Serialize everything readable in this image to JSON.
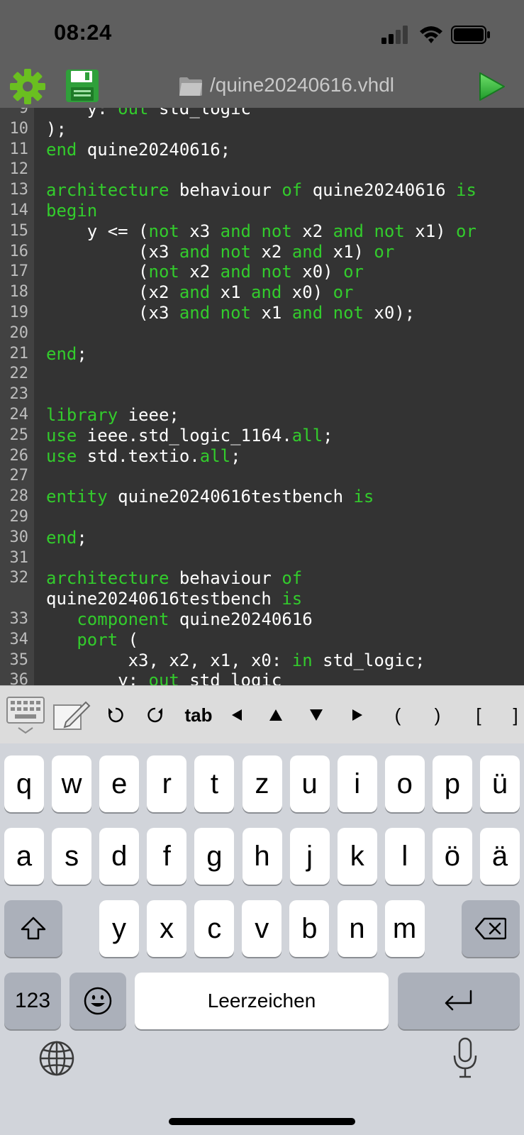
{
  "status_bar": {
    "time": "08:24"
  },
  "toolbar": {
    "file_title": "/quine20240616.vhdl"
  },
  "colors": {
    "keyword": "#33cc2c",
    "text": "#ffffff",
    "editor_bg": "#333333",
    "gutter_bg": "#424242"
  },
  "code": {
    "lines": [
      {
        "num": "9",
        "segs": [
          [
            "t",
            "    y: "
          ],
          [
            "k",
            "out"
          ],
          [
            "t",
            " std_logic"
          ]
        ]
      },
      {
        "num": "10",
        "segs": [
          [
            "t",
            ");"
          ]
        ]
      },
      {
        "num": "11",
        "segs": [
          [
            "k",
            "end"
          ],
          [
            "t",
            " quine20240616;"
          ]
        ]
      },
      {
        "num": "12",
        "segs": []
      },
      {
        "num": "13",
        "segs": [
          [
            "k",
            "architecture"
          ],
          [
            "t",
            " behaviour "
          ],
          [
            "k",
            "of"
          ],
          [
            "t",
            " quine20240616 "
          ],
          [
            "k",
            "is"
          ]
        ]
      },
      {
        "num": "14",
        "segs": [
          [
            "k",
            "begin"
          ]
        ]
      },
      {
        "num": "15",
        "segs": [
          [
            "t",
            "    y <= ("
          ],
          [
            "k",
            "not"
          ],
          [
            "t",
            " x3 "
          ],
          [
            "k",
            "and"
          ],
          [
            "t",
            " "
          ],
          [
            "k",
            "not"
          ],
          [
            "t",
            " x2 "
          ],
          [
            "k",
            "and"
          ],
          [
            "t",
            " "
          ],
          [
            "k",
            "not"
          ],
          [
            "t",
            " x1) "
          ],
          [
            "k",
            "or"
          ]
        ]
      },
      {
        "num": "16",
        "segs": [
          [
            "t",
            "         (x3 "
          ],
          [
            "k",
            "and"
          ],
          [
            "t",
            " "
          ],
          [
            "k",
            "not"
          ],
          [
            "t",
            " x2 "
          ],
          [
            "k",
            "and"
          ],
          [
            "t",
            " x1) "
          ],
          [
            "k",
            "or"
          ]
        ]
      },
      {
        "num": "17",
        "segs": [
          [
            "t",
            "         ("
          ],
          [
            "k",
            "not"
          ],
          [
            "t",
            " x2 "
          ],
          [
            "k",
            "and"
          ],
          [
            "t",
            " "
          ],
          [
            "k",
            "not"
          ],
          [
            "t",
            " x0) "
          ],
          [
            "k",
            "or"
          ]
        ]
      },
      {
        "num": "18",
        "segs": [
          [
            "t",
            "         (x2 "
          ],
          [
            "k",
            "and"
          ],
          [
            "t",
            " x1 "
          ],
          [
            "k",
            "and"
          ],
          [
            "t",
            " x0) "
          ],
          [
            "k",
            "or"
          ]
        ]
      },
      {
        "num": "19",
        "segs": [
          [
            "t",
            "         (x3 "
          ],
          [
            "k",
            "and"
          ],
          [
            "t",
            " "
          ],
          [
            "k",
            "not"
          ],
          [
            "t",
            " x1 "
          ],
          [
            "k",
            "and"
          ],
          [
            "t",
            " "
          ],
          [
            "k",
            "not"
          ],
          [
            "t",
            " x0);"
          ]
        ]
      },
      {
        "num": "20",
        "segs": []
      },
      {
        "num": "21",
        "segs": [
          [
            "k",
            "end"
          ],
          [
            "t",
            ";"
          ]
        ]
      },
      {
        "num": "22",
        "segs": []
      },
      {
        "num": "23",
        "segs": []
      },
      {
        "num": "24",
        "segs": [
          [
            "k",
            "library"
          ],
          [
            "t",
            " ieee;"
          ]
        ]
      },
      {
        "num": "25",
        "segs": [
          [
            "k",
            "use"
          ],
          [
            "t",
            " ieee.std_logic_1164."
          ],
          [
            "k",
            "all"
          ],
          [
            "t",
            ";"
          ]
        ]
      },
      {
        "num": "26",
        "segs": [
          [
            "k",
            "use"
          ],
          [
            "t",
            " std.textio."
          ],
          [
            "k",
            "all"
          ],
          [
            "t",
            ";"
          ]
        ]
      },
      {
        "num": "27",
        "segs": []
      },
      {
        "num": "28",
        "segs": [
          [
            "k",
            "entity"
          ],
          [
            "t",
            " quine20240616testbench "
          ],
          [
            "k",
            "is"
          ]
        ]
      },
      {
        "num": "29",
        "segs": []
      },
      {
        "num": "30",
        "segs": [
          [
            "k",
            "end"
          ],
          [
            "t",
            ";"
          ]
        ]
      },
      {
        "num": "31",
        "segs": []
      },
      {
        "num": "32",
        "segs": [
          [
            "k",
            "architecture"
          ],
          [
            "t",
            " behaviour "
          ],
          [
            "k",
            "of"
          ]
        ]
      },
      {
        "num": "",
        "segs": [
          [
            "t",
            "quine20240616testbench "
          ],
          [
            "k",
            "is"
          ]
        ]
      },
      {
        "num": "33",
        "segs": [
          [
            "t",
            "   "
          ],
          [
            "k",
            "component"
          ],
          [
            "t",
            " quine20240616"
          ]
        ]
      },
      {
        "num": "34",
        "segs": [
          [
            "t",
            "   "
          ],
          [
            "k",
            "port"
          ],
          [
            "t",
            " ("
          ]
        ]
      },
      {
        "num": "35",
        "segs": [
          [
            "t",
            "        x3, x2, x1, x0: "
          ],
          [
            "k",
            "in"
          ],
          [
            "t",
            " std_logic;"
          ]
        ]
      },
      {
        "num": "36",
        "segs": [
          [
            "t",
            "       y: "
          ],
          [
            "k",
            "out"
          ],
          [
            "t",
            " std_logic"
          ]
        ]
      }
    ]
  },
  "accessory_bar": {
    "tab_label": "tab",
    "open_paren": "(",
    "close_paren": ")",
    "open_bracket": "[",
    "close_bracket": "]"
  },
  "keyboard": {
    "row1": [
      "q",
      "w",
      "e",
      "r",
      "t",
      "z",
      "u",
      "i",
      "o",
      "p",
      "ü"
    ],
    "row2": [
      "a",
      "s",
      "d",
      "f",
      "g",
      "h",
      "j",
      "k",
      "l",
      "ö",
      "ä"
    ],
    "row3": [
      "y",
      "x",
      "c",
      "v",
      "b",
      "n",
      "m"
    ],
    "numbers_label": "123",
    "space_label": "Leerzeichen"
  }
}
